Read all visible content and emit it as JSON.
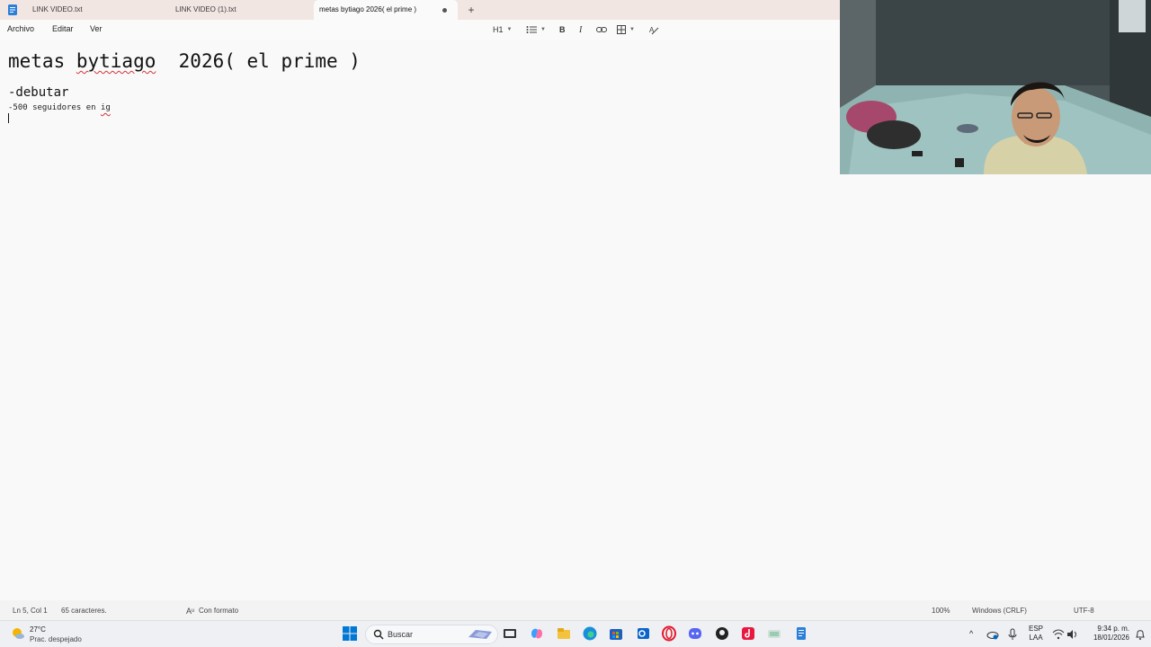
{
  "tabs": [
    {
      "label": "LINK VIDEO.txt"
    },
    {
      "label": "LINK VIDEO (1).txt"
    },
    {
      "label": "metas bytiago  2026( el prime )"
    }
  ],
  "menu": {
    "file": "Archivo",
    "edit": "Editar",
    "view": "Ver"
  },
  "toolbar": {
    "heading": "H1"
  },
  "document": {
    "h1_part1": "metas ",
    "h1_squiggle": "bytiago",
    "h1_part2": "  2026( el prime )",
    "h2": "-debutar",
    "line3_text": "-500 seguidores en ",
    "line3_squiggle": "ig"
  },
  "status": {
    "position": "Ln 5, Col 1",
    "chars": "65 caracteres.",
    "format": "Con formato",
    "zoom": "100%",
    "line_ending": "Windows (CRLF)",
    "encoding": "UTF-8"
  },
  "taskbar": {
    "weather_temp": "27°C",
    "weather_cond": "Prac. despejado",
    "search_label": "Buscar",
    "lang_1": "ESP",
    "lang_2": "LAA",
    "time": "9:34 p. m.",
    "date": "18/01/2026"
  },
  "colors": {
    "accent": "#0067c0",
    "spell_error": "#d13438"
  }
}
